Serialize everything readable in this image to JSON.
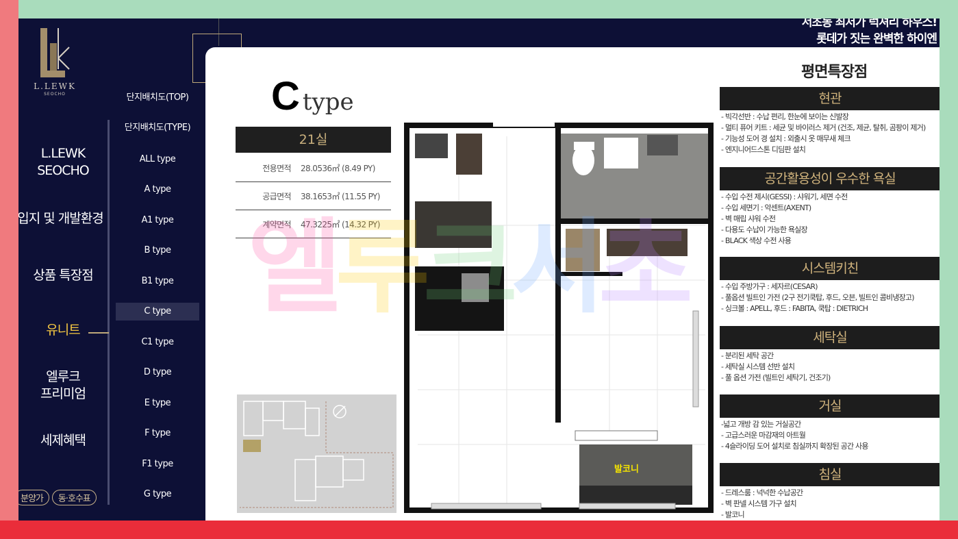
{
  "brand": {
    "name": "L.LEWK",
    "sub": "SEOCHO"
  },
  "slogan": {
    "line1": "서초동 최저가 럭셔리 하우스!",
    "line2": "롯데가 짓는 완벽한 하이엔"
  },
  "main_nav": [
    {
      "label": "L.LEWK\nSEOCHO"
    },
    {
      "label": "입지 및 개발환경"
    },
    {
      "label": "상품 특장점"
    },
    {
      "label": "유니트"
    },
    {
      "label": "엘루크\n프리미엄"
    },
    {
      "label": "세제혜택"
    }
  ],
  "bottom_buttons": {
    "price": "분양가",
    "units": "동·호수표"
  },
  "sub_nav": [
    "단지배치도(TOP)",
    "단지배치도(TYPE)",
    "ALL  type",
    "A  type",
    "A1  type",
    "B  type",
    "B1  type",
    "C  type",
    "C1  type",
    "D  type",
    "E  type",
    "F  type",
    "F1  type",
    "G  type"
  ],
  "unit": {
    "letter": "C",
    "word": "type",
    "room_count": "21실",
    "specs": [
      {
        "label": "전용면적",
        "value": "28.0536㎡ (8.49 PY)"
      },
      {
        "label": "공급면적",
        "value": "38.1653㎡ (11.55 PY)"
      },
      {
        "label": "계약면적",
        "value": "47.3225㎡ (14.32 PY)"
      }
    ],
    "balcony_label": "발코니"
  },
  "watermark": {
    "chars": [
      "엘",
      "루",
      "크",
      "서",
      "초"
    ]
  },
  "features": {
    "title": "평면특장점",
    "sections": [
      {
        "heading": "현관",
        "items": [
          "- 빅각선반 : 수납 편리, 한눈에 보이는 신발장",
          "- 멀티 퓨어 키트 : 세균 및 바이러스 제거 (건조, 제균, 탈취, 곰팡이 제거)",
          "- 기능성 도어 경 설치 : 외출시 옷 매무새 체크",
          "- 엔지니어드스톤 디딤판 설치"
        ]
      },
      {
        "heading": "공간활용성이 우수한 욕실",
        "items": [
          "- 수입 수전 제시(GESSI) : 샤워기, 세면 수전",
          "- 수입 세면기 : 악센트(AXENT)",
          "- 벽 매립 샤워 수전",
          "- 다용도 수납이 가능한 욕실장",
          "- BLACK 색상 수전 사용"
        ]
      },
      {
        "heading": "시스템키친",
        "items": [
          "- 수입 주방가구 : 세자르(CESAR)",
          "- 풀옵션 빌트인 가전 (2구 전기쿡탑, 후드, 오븐, 빌트인 콤비냉장고)",
          "- 싱크볼 : APELL, 후드 : FABITA, 쿡탑 : DIETRICH"
        ]
      },
      {
        "heading": "세탁실",
        "items": [
          "- 분리된 세탁 공간",
          "- 세탁실 시스템 선반 설치",
          "- 풀 옵션 가전 (빌트인 세탁기, 건조기)"
        ]
      },
      {
        "heading": "거실",
        "items": [
          "-넓고 개방 감 있는 거실공간",
          "- 고급스러운 마감재의 아트월",
          "- 4슬라이딩 도어 설치로 침실까지 확장된 공간 사용"
        ]
      },
      {
        "heading": "침실",
        "items": [
          "- 드레스룸 : 넉넉한 수납공간",
          "- 벽 판넬 시스템 가구 설치",
          "- 발코니"
        ]
      }
    ]
  },
  "colors": {
    "navy": "#0d1036",
    "gold": "#c9b07e",
    "active": "#f5c842"
  }
}
